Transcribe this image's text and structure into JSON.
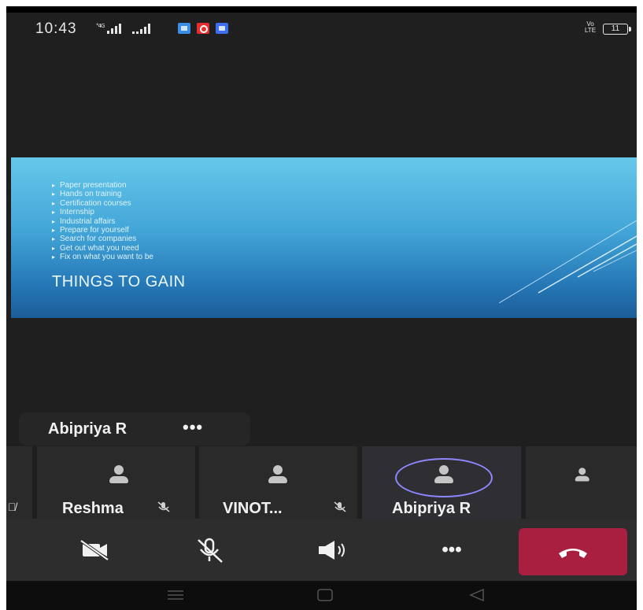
{
  "status_bar": {
    "time": "10:43",
    "signal_text": "ᵃᴸᴸ ᵢ.ıl ..ıl",
    "volte": "Vo LTE",
    "battery": "11"
  },
  "slide": {
    "bullets": [
      "Paper presentation",
      "Hands on training",
      "Certification courses",
      "Internship",
      "Industrial affairs",
      "Prepare for yourself",
      "Search for companies",
      "Get out what you need",
      "Fix on what you want to be"
    ],
    "title": "THINGS TO GAIN"
  },
  "speaker": {
    "name": "Abipriya R",
    "more": "•••"
  },
  "participants": [
    {
      "name": ""
    },
    {
      "name": "Reshma"
    },
    {
      "name": "VINOT..."
    },
    {
      "name": "Abipriya R"
    },
    {
      "name": ""
    }
  ],
  "controls": {
    "more": "•••"
  },
  "colors": {
    "background": "#1f1f1f",
    "hangup": "#a81f3f",
    "speaking_ring": "#8e86ff",
    "slide_top": "#66c8ea",
    "slide_bottom": "#1c5d98"
  },
  "icons": [
    "video-off-icon",
    "mic-off-icon",
    "speaker-icon",
    "more-icon",
    "hang-up-icon"
  ]
}
